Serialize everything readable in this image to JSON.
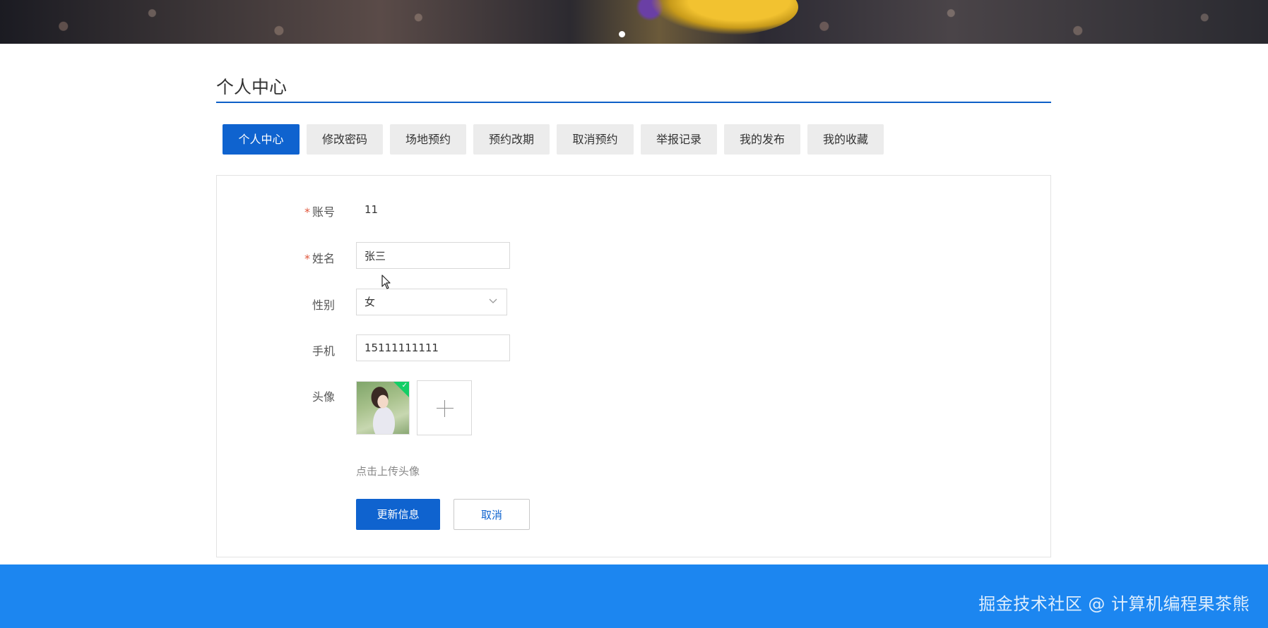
{
  "page": {
    "section_title": "个人中心"
  },
  "tabs": [
    {
      "label": "个人中心",
      "active": true
    },
    {
      "label": "修改密码",
      "active": false
    },
    {
      "label": "场地预约",
      "active": false
    },
    {
      "label": "预约改期",
      "active": false
    },
    {
      "label": "取消预约",
      "active": false
    },
    {
      "label": "举报记录",
      "active": false
    },
    {
      "label": "我的发布",
      "active": false
    },
    {
      "label": "我的收藏",
      "active": false
    }
  ],
  "form": {
    "required_mark": "*",
    "account": {
      "label": "账号",
      "value": "11"
    },
    "name": {
      "label": "姓名",
      "value": "张三"
    },
    "gender": {
      "label": "性别",
      "value": "女"
    },
    "phone": {
      "label": "手机",
      "value": "15111111111"
    },
    "avatar": {
      "label": "头像",
      "upload_hint": "点击上传头像"
    },
    "update_button": "更新信息",
    "cancel_button": "取消"
  },
  "footer": {
    "watermark": "掘金技术社区 @ 计算机编程果茶熊"
  },
  "icons": {
    "upload": "plus-icon",
    "select": "chevron-down-icon",
    "uploaded": "check-icon",
    "cursor": "mouse-pointer-icon"
  },
  "colors": {
    "primary": "#0f63cf",
    "footer": "#1c86f0",
    "tab_inactive": "#ececec",
    "required": "#e0573c",
    "success": "#13ce66"
  }
}
